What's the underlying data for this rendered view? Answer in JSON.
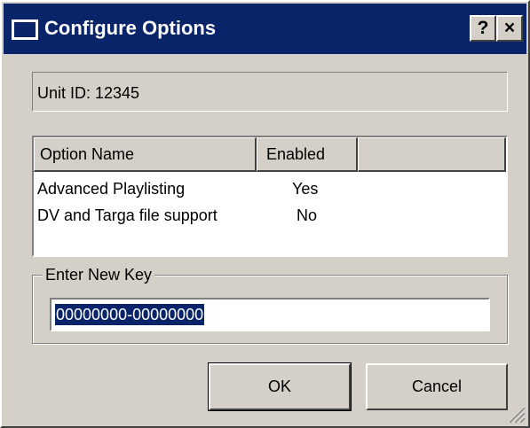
{
  "window": {
    "title": "Configure Options",
    "help_label": "?",
    "close_label": "×"
  },
  "unit": {
    "label": "Unit ID: 12345"
  },
  "list": {
    "columns": [
      "Option Name",
      "Enabled",
      ""
    ],
    "rows": [
      {
        "name": "Advanced Playlisting",
        "enabled": "Yes"
      },
      {
        "name": "DV and Targa file support",
        "enabled": "No"
      }
    ]
  },
  "key_group": {
    "label": "Enter New Key",
    "value": "00000000-00000000"
  },
  "buttons": {
    "ok": "OK",
    "cancel": "Cancel"
  },
  "icons": {
    "title_icon": "window-icon",
    "grip": "resize-grip-icon"
  },
  "colors": {
    "titlebar": "#0a246a",
    "face": "#d4d0c8",
    "selection": "#0a246a"
  }
}
